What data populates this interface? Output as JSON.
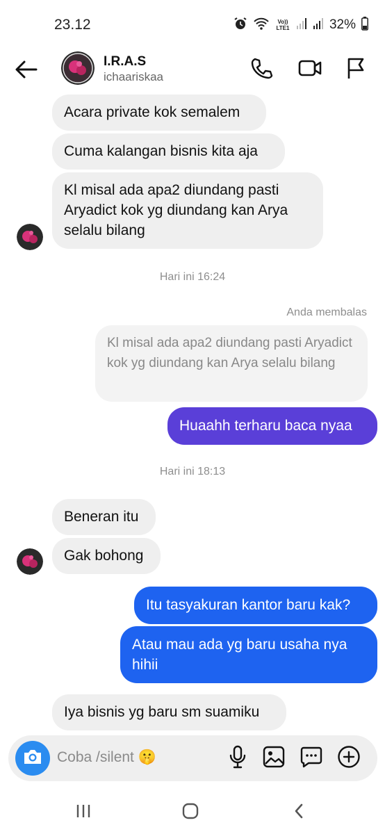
{
  "status_bar": {
    "time": "23.12",
    "battery": "32%",
    "icons": [
      "alarm-icon",
      "wifi-icon",
      "volte-icon",
      "signal-icon",
      "signal-icon",
      "battery-icon"
    ],
    "volte_label": "Vo)) LTE1"
  },
  "header": {
    "name": "I.R.A.S",
    "username": "ichaariskaa",
    "icons": [
      "back-arrow-icon",
      "phone-icon",
      "video-icon",
      "flag-icon"
    ]
  },
  "messages": [
    {
      "side": "in",
      "text": "Acara private kok semalem"
    },
    {
      "side": "in",
      "text": "Cuma kalangan bisnis kita aja"
    },
    {
      "side": "in",
      "text": "Kl misal ada apa2 diundang pasti Aryadict kok yg diundang kan Arya selalu bilang"
    },
    {
      "type": "timestamp",
      "text": "Hari ini 16:24"
    },
    {
      "type": "reply_label",
      "text": "Anda membalas"
    },
    {
      "type": "quote",
      "text": "Kl misal ada apa2 diundang pasti Aryadict kok yg diundang kan Arya selalu bilang"
    },
    {
      "side": "out",
      "text": "Huaahh terharu baca nyaa",
      "color": "#5a3fd8"
    },
    {
      "type": "timestamp",
      "text": "Hari ini 18:13"
    },
    {
      "side": "in",
      "text": "Beneran itu"
    },
    {
      "side": "in",
      "text": "Gak bohong"
    },
    {
      "side": "out",
      "text": "Itu tasyakuran kantor baru kak?",
      "color": "#1e63f0"
    },
    {
      "side": "out",
      "text": "Atau mau ada yg baru usaha nya hihii",
      "color": "#1e63f0"
    },
    {
      "side": "in",
      "text": "Iya bisnis yg baru sm suamiku"
    }
  ],
  "composer": {
    "placeholder": "Coba /silent 🤫",
    "icons": [
      "camera-icon",
      "microphone-icon",
      "gallery-icon",
      "sticker-icon",
      "add-icon"
    ]
  },
  "nav_bar": {
    "icons": [
      "recents-icon",
      "home-icon",
      "back-icon"
    ]
  },
  "colors": {
    "incoming_bubble": "#efefef",
    "outgoing_purple": "#5a3fd8",
    "outgoing_blue": "#1e63f0",
    "camera_button": "#2b8cf0"
  }
}
